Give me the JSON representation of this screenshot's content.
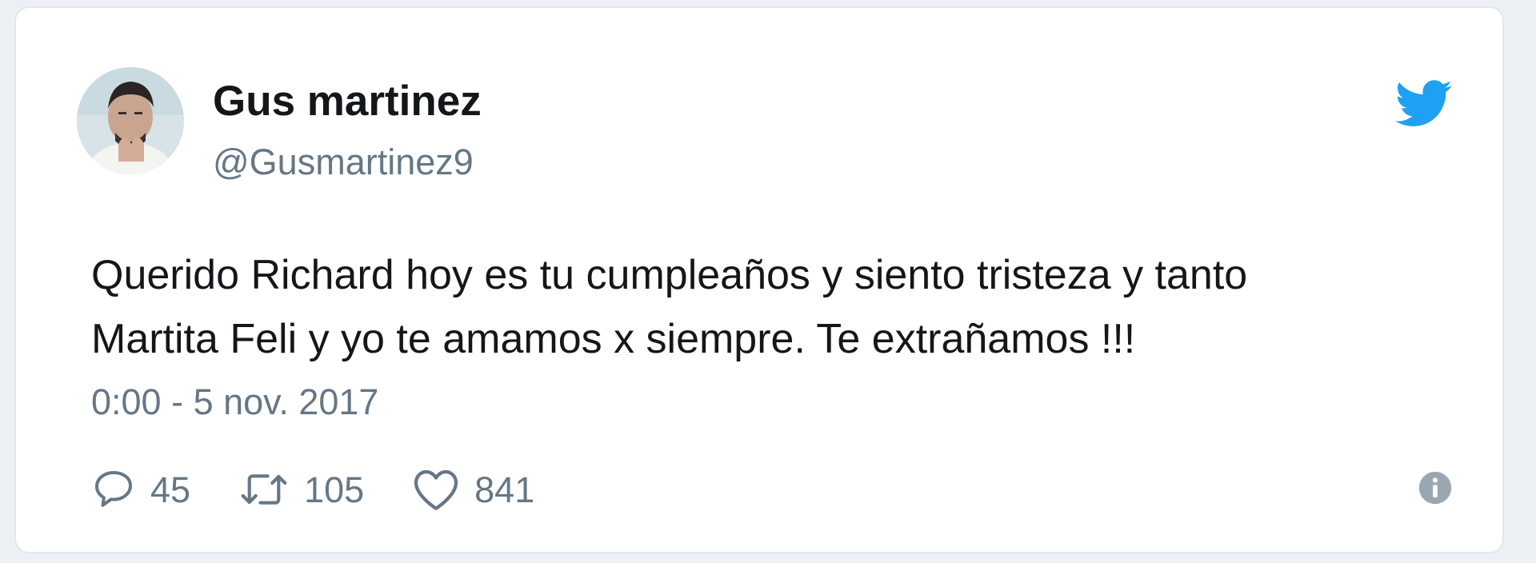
{
  "tweet": {
    "author_name": "Gus martinez",
    "handle": "@Gusmartinez9",
    "text_line_1": "Querido Richard hoy es tu cumpleaños y siento tristeza y tanto",
    "text_line_2": "Martita Feli y yo te amamos x siempre. Te extrañamos !!!",
    "timestamp": "0:00 - 5 nov. 2017"
  },
  "actions": {
    "replies": "45",
    "retweets": "105",
    "likes": "841"
  },
  "icons": {
    "brand": "twitter-bird-icon",
    "reply": "reply-icon",
    "retweet": "retweet-icon",
    "like": "heart-icon",
    "info": "info-icon"
  },
  "colors": {
    "brand": "#1da1f2",
    "text": "#14171a",
    "secondary": "#657786",
    "border": "#e1e8ed"
  }
}
